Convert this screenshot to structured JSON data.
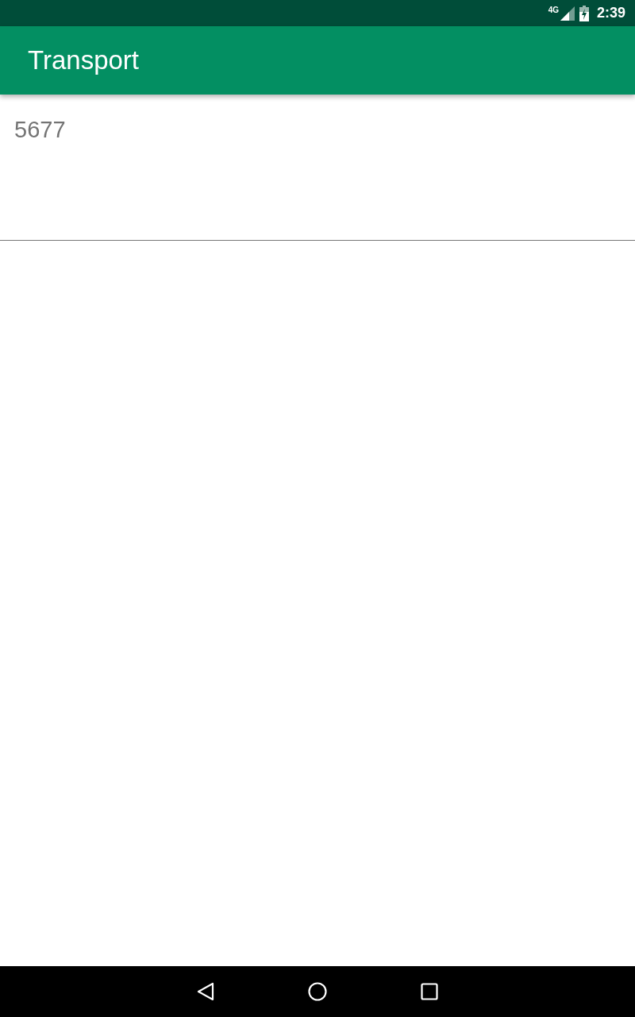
{
  "status_bar": {
    "network": "4G",
    "time": "2:39"
  },
  "app_bar": {
    "title": "Transport"
  },
  "text_field": {
    "value": "5677"
  }
}
